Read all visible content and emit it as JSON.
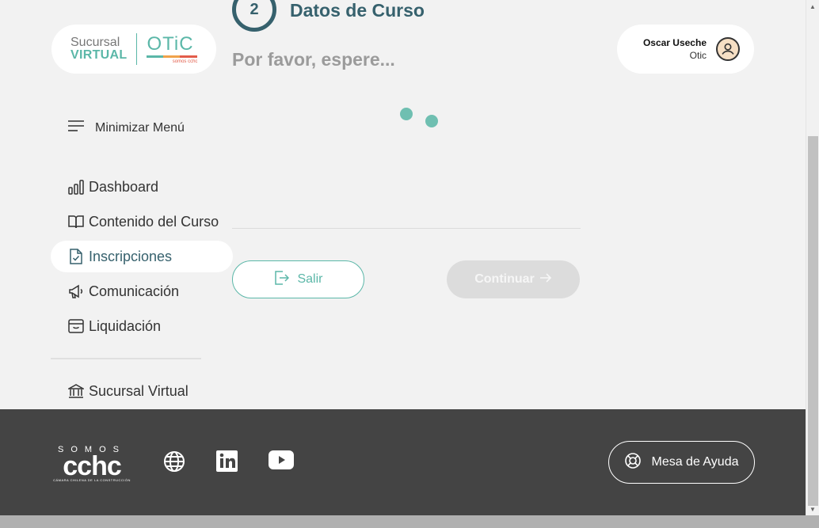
{
  "brand": {
    "sucursal_line1": "Sucursal",
    "sucursal_line2": "VIRTUAL",
    "otic_name": "OTiC",
    "otic_tagline": "somos cchc"
  },
  "step": {
    "number": "2",
    "title": "Datos de Curso",
    "status": "Por favor, espere..."
  },
  "user": {
    "name": "Oscar Useche",
    "org": "Otic",
    "icon": "user-circle-icon"
  },
  "sidebar": {
    "toggle_label": "Minimizar Menú",
    "items": [
      {
        "label": "Dashboard",
        "icon": "bar-chart-icon"
      },
      {
        "label": "Contenido del Curso",
        "icon": "book-icon"
      },
      {
        "label": "Inscripciones",
        "icon": "file-check-icon",
        "active": true
      },
      {
        "label": "Comunicación",
        "icon": "megaphone-icon"
      },
      {
        "label": "Liquidación",
        "icon": "wallet-icon"
      }
    ],
    "bottom_item": {
      "label": "Sucursal Virtual",
      "icon": "bank-icon"
    }
  },
  "actions": {
    "exit_label": "Salir",
    "continue_label": "Continuar"
  },
  "footer": {
    "logo_top": "SOMOS",
    "logo_main": "cchc",
    "logo_sub": "CÁMARA CHILENA DE LA CONSTRUCCIÓN",
    "help_label": "Mesa de Ayuda"
  },
  "colors": {
    "primary": "#36616d",
    "accent": "#5bb7a8",
    "footer_bg": "#444444",
    "page_bg": "#f2f2f2"
  }
}
